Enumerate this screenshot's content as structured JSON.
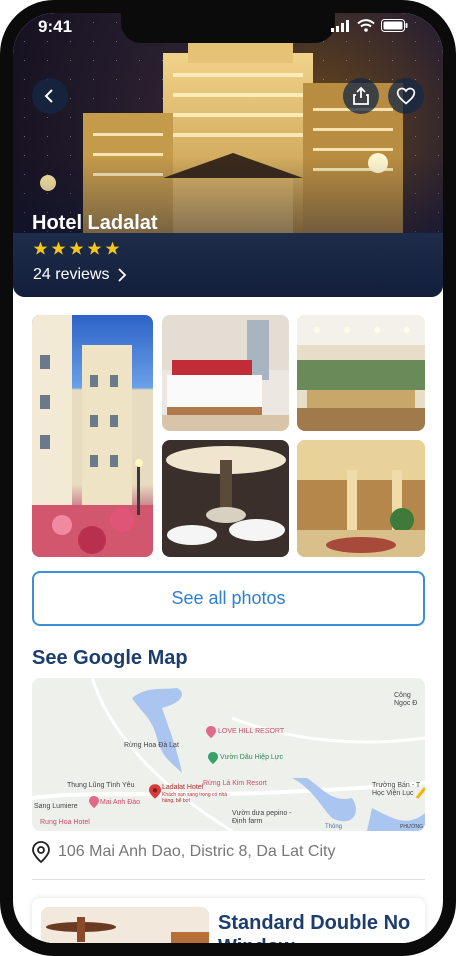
{
  "status": {
    "time": "9:41"
  },
  "hotel": {
    "name": "Hotel Ladalat",
    "rating": 5,
    "reviews_label": "24 reviews"
  },
  "actions": {
    "see_all_photos": "See all photos"
  },
  "map": {
    "title": "See Google Map",
    "labels": {
      "love_hill": "LOVE HILL RESORT",
      "rung_hoa": "Rừng Hoa Đà Lạt",
      "vuon_dau": "Vườn Dâu Hiệp Lực",
      "thung_lung": "Thung Lũng Tình Yêu",
      "ladalat": "Ladalat Hotel",
      "ladalat_sub": "Khách sạn sang trọng có nhà hàng, bể bơi",
      "rung_la_kim": "Rừng Lá Kim Resort",
      "mai_anh_dao": "Mai Anh Đào",
      "lumiere": "Sang Lumiere",
      "rung_hoa_hotel": "Rung Hoa Hotel",
      "vuon_pepino": "Vườn dưa pepino - Định farm",
      "truong_ban": "Trường Bán - T Học Viện Lục",
      "cong_ngoc": "Công Ngọc Đ",
      "thong": "Thông",
      "phuong": "PHƯỜNG"
    }
  },
  "address": "106 Mai Anh Dao, Distric 8, Da Lat City",
  "room": {
    "title": "Standard Double No Window"
  },
  "colors": {
    "accent": "#2f7fd1",
    "title": "#1c3d6e",
    "star": "#f5c518"
  }
}
